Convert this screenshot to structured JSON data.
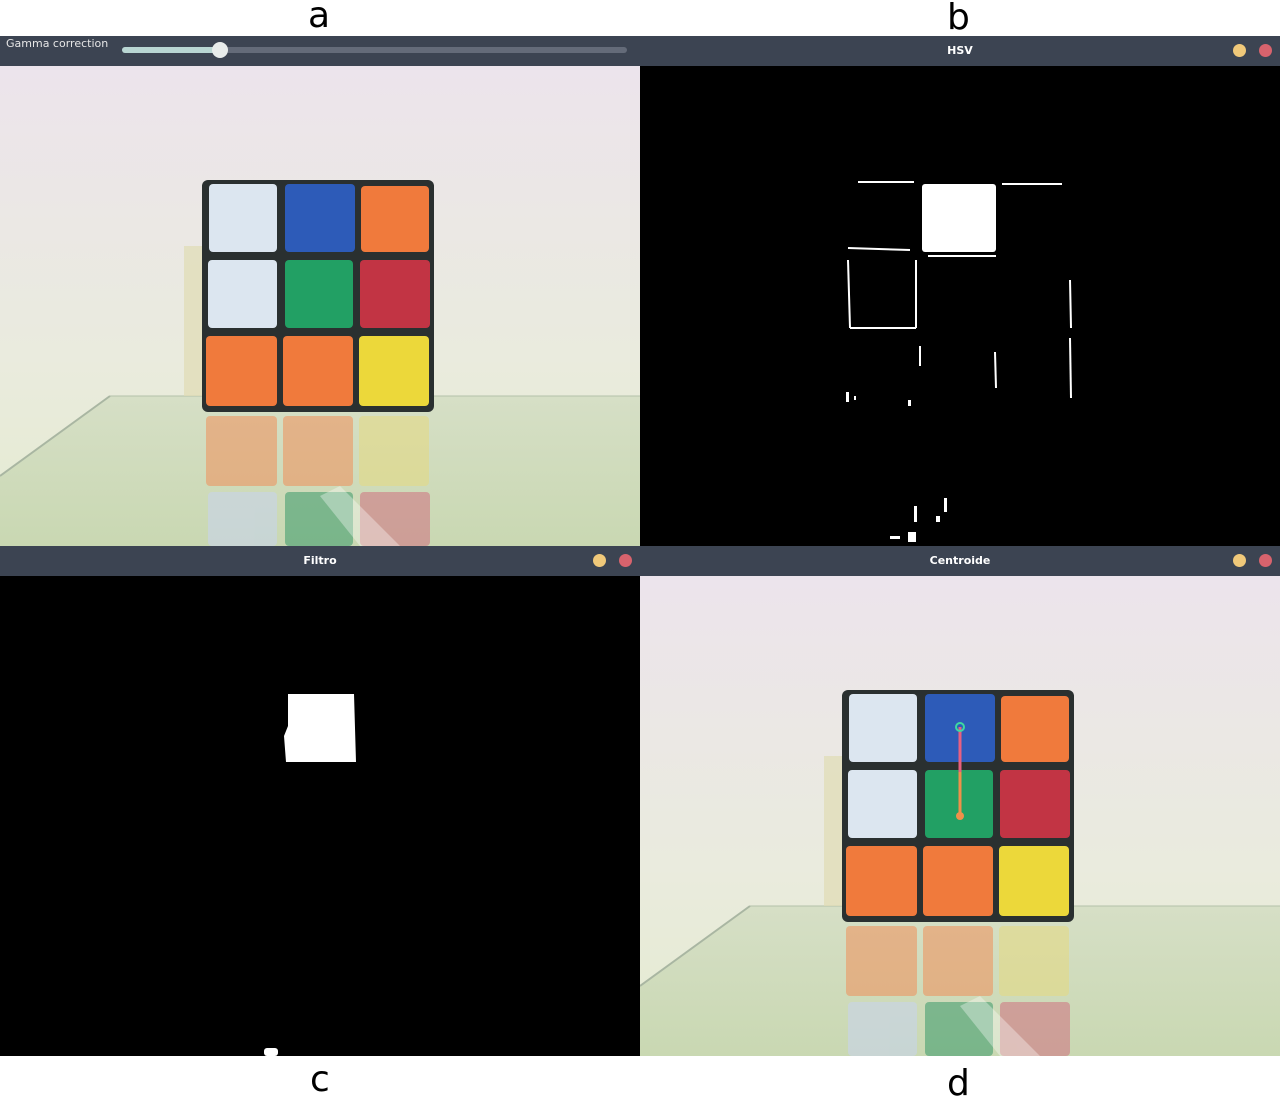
{
  "panel_letters": {
    "a": "a",
    "b": "b",
    "c": "c",
    "d": "d"
  },
  "windows": {
    "gamma": {
      "slider_label": "Gamma correction",
      "slider_value": 0.195,
      "track_color": "#646b79",
      "fill_color": "#b9d6d3",
      "thumb_color": "#e8eceb"
    },
    "hsv": {
      "title": "HSV"
    },
    "filtro": {
      "title": "Filtro"
    },
    "centroide": {
      "title": "Centroide"
    }
  },
  "icons": {
    "minimize": "minimize-icon",
    "close": "close-icon"
  },
  "colors": {
    "titlebar_bg": "#3c4452",
    "minimize": "#f0c97a",
    "close": "#d8636d",
    "cube_white": "#dce6f0",
    "cube_blue": "#2d5bb8",
    "cube_orange": "#f07a3c",
    "cube_green": "#22a064",
    "cube_red": "#c23444",
    "cube_yellow": "#ecd83a",
    "centroid_green": "#3ed8a0",
    "centroid_orange": "#f0904a",
    "centroid_line": "#e86080"
  }
}
